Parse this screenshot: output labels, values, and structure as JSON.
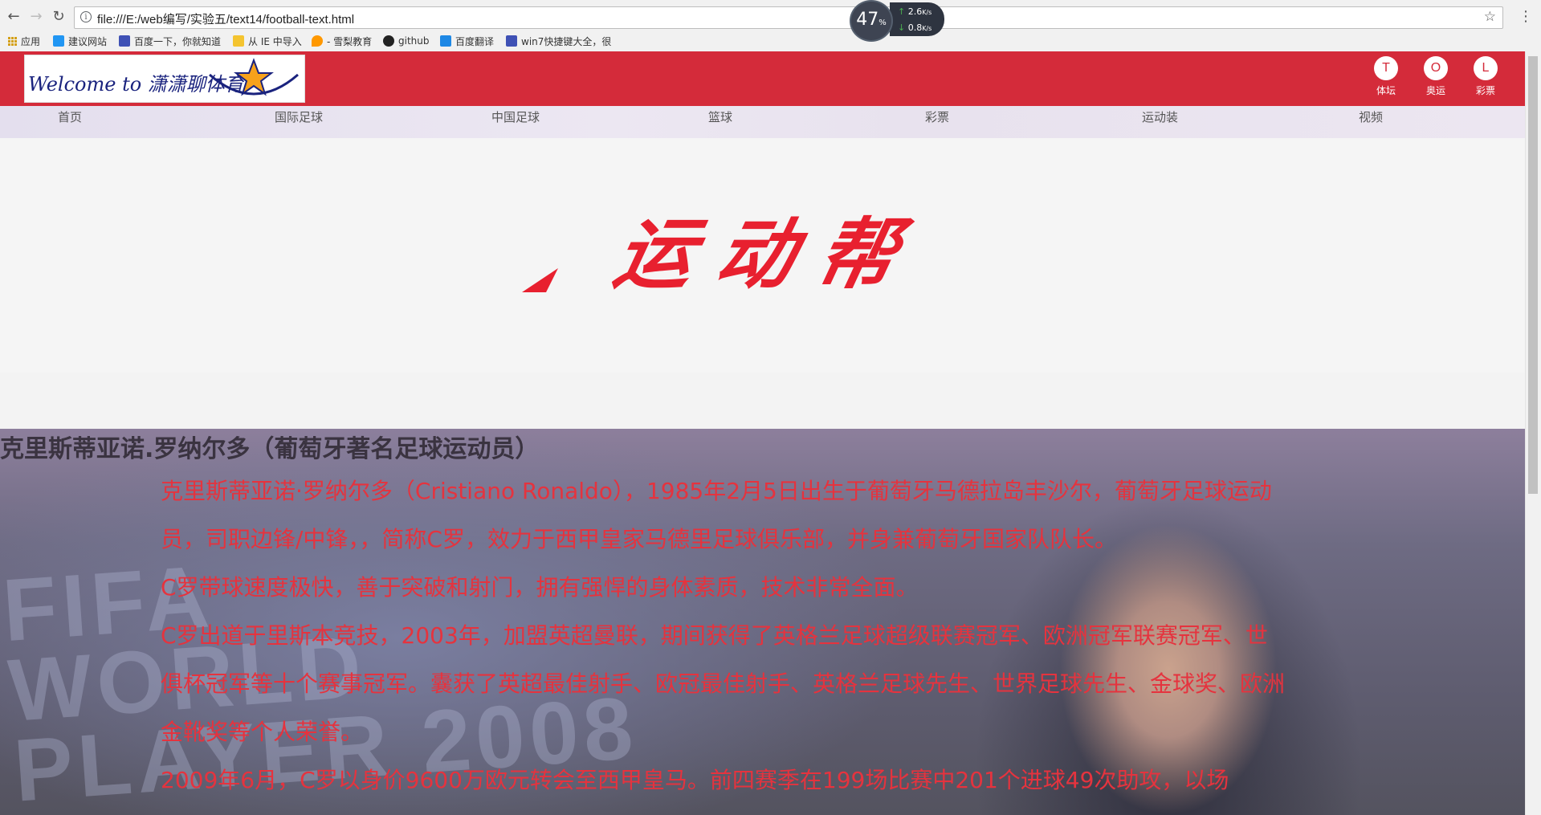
{
  "browser": {
    "url": "file:///E:/web编写/实验五/text14/football-text.html",
    "bookmarks": [
      {
        "label": "应用",
        "color": "#d4a017"
      },
      {
        "label": "建议网站",
        "color": "#2196f3"
      },
      {
        "label": "百度一下，你就知道",
        "color": "#3f51b5"
      },
      {
        "label": "从 IE 中导入",
        "color": "#f4c430"
      },
      {
        "label": "- 雪梨教育",
        "color": "#ff9800"
      },
      {
        "label": "github",
        "color": "#222222"
      },
      {
        "label": "百度翻译",
        "color": "#1e88e5"
      },
      {
        "label": "win7快捷键大全，很",
        "color": "#3f51b5"
      }
    ],
    "speed": {
      "percent": "47",
      "unit": "%",
      "up": "2.6",
      "down": "0.8",
      "rate_unit": "K/s"
    }
  },
  "site": {
    "logo_text": "Welcome to 潇潇聊体育",
    "top_links": [
      {
        "letter": "T",
        "label": "体坛"
      },
      {
        "letter": "O",
        "label": "奥运"
      },
      {
        "letter": "L",
        "label": "彩票"
      }
    ],
    "nav": [
      "首页",
      "国际足球",
      "中国足球",
      "篮球",
      "彩票",
      "运动装",
      "视频"
    ],
    "brand_text": "运动帮",
    "brand_color": "#e8202f",
    "header_color": "#d42b3a"
  },
  "article": {
    "title": "克里斯蒂亚诺.罗纳尔多（葡萄牙著名足球运动员）",
    "bg_text": "FIFA\nWORLD\nPLAYER 2008",
    "paragraphs": [
      "克里斯蒂亚诺·罗纳尔多（Cristiano Ronaldo），1985年2月5日出生于葡萄牙马德拉岛丰沙尔，葡萄牙足球运动员，司职边锋/中锋，，简称C罗，效力于西甲皇家马德里足球俱乐部，并身兼葡萄牙国家队队长。",
      "C罗带球速度极快，善于突破和射门，拥有强悍的身体素质，技术非常全面。",
      "C罗出道于里斯本竞技，2003年，加盟英超曼联，期间获得了英格兰足球超级联赛冠军、欧洲冠军联赛冠军、世俱杯冠军等十个赛事冠军。囊获了英超最佳射手、欧冠最佳射手、英格兰足球先生、世界足球先生、金球奖、欧洲金靴奖等个人荣誉。",
      "2009年6月，C罗以身价9600万欧元转会至西甲皇马。前四赛季在199场比赛中201个进球49次助攻，以场"
    ]
  }
}
